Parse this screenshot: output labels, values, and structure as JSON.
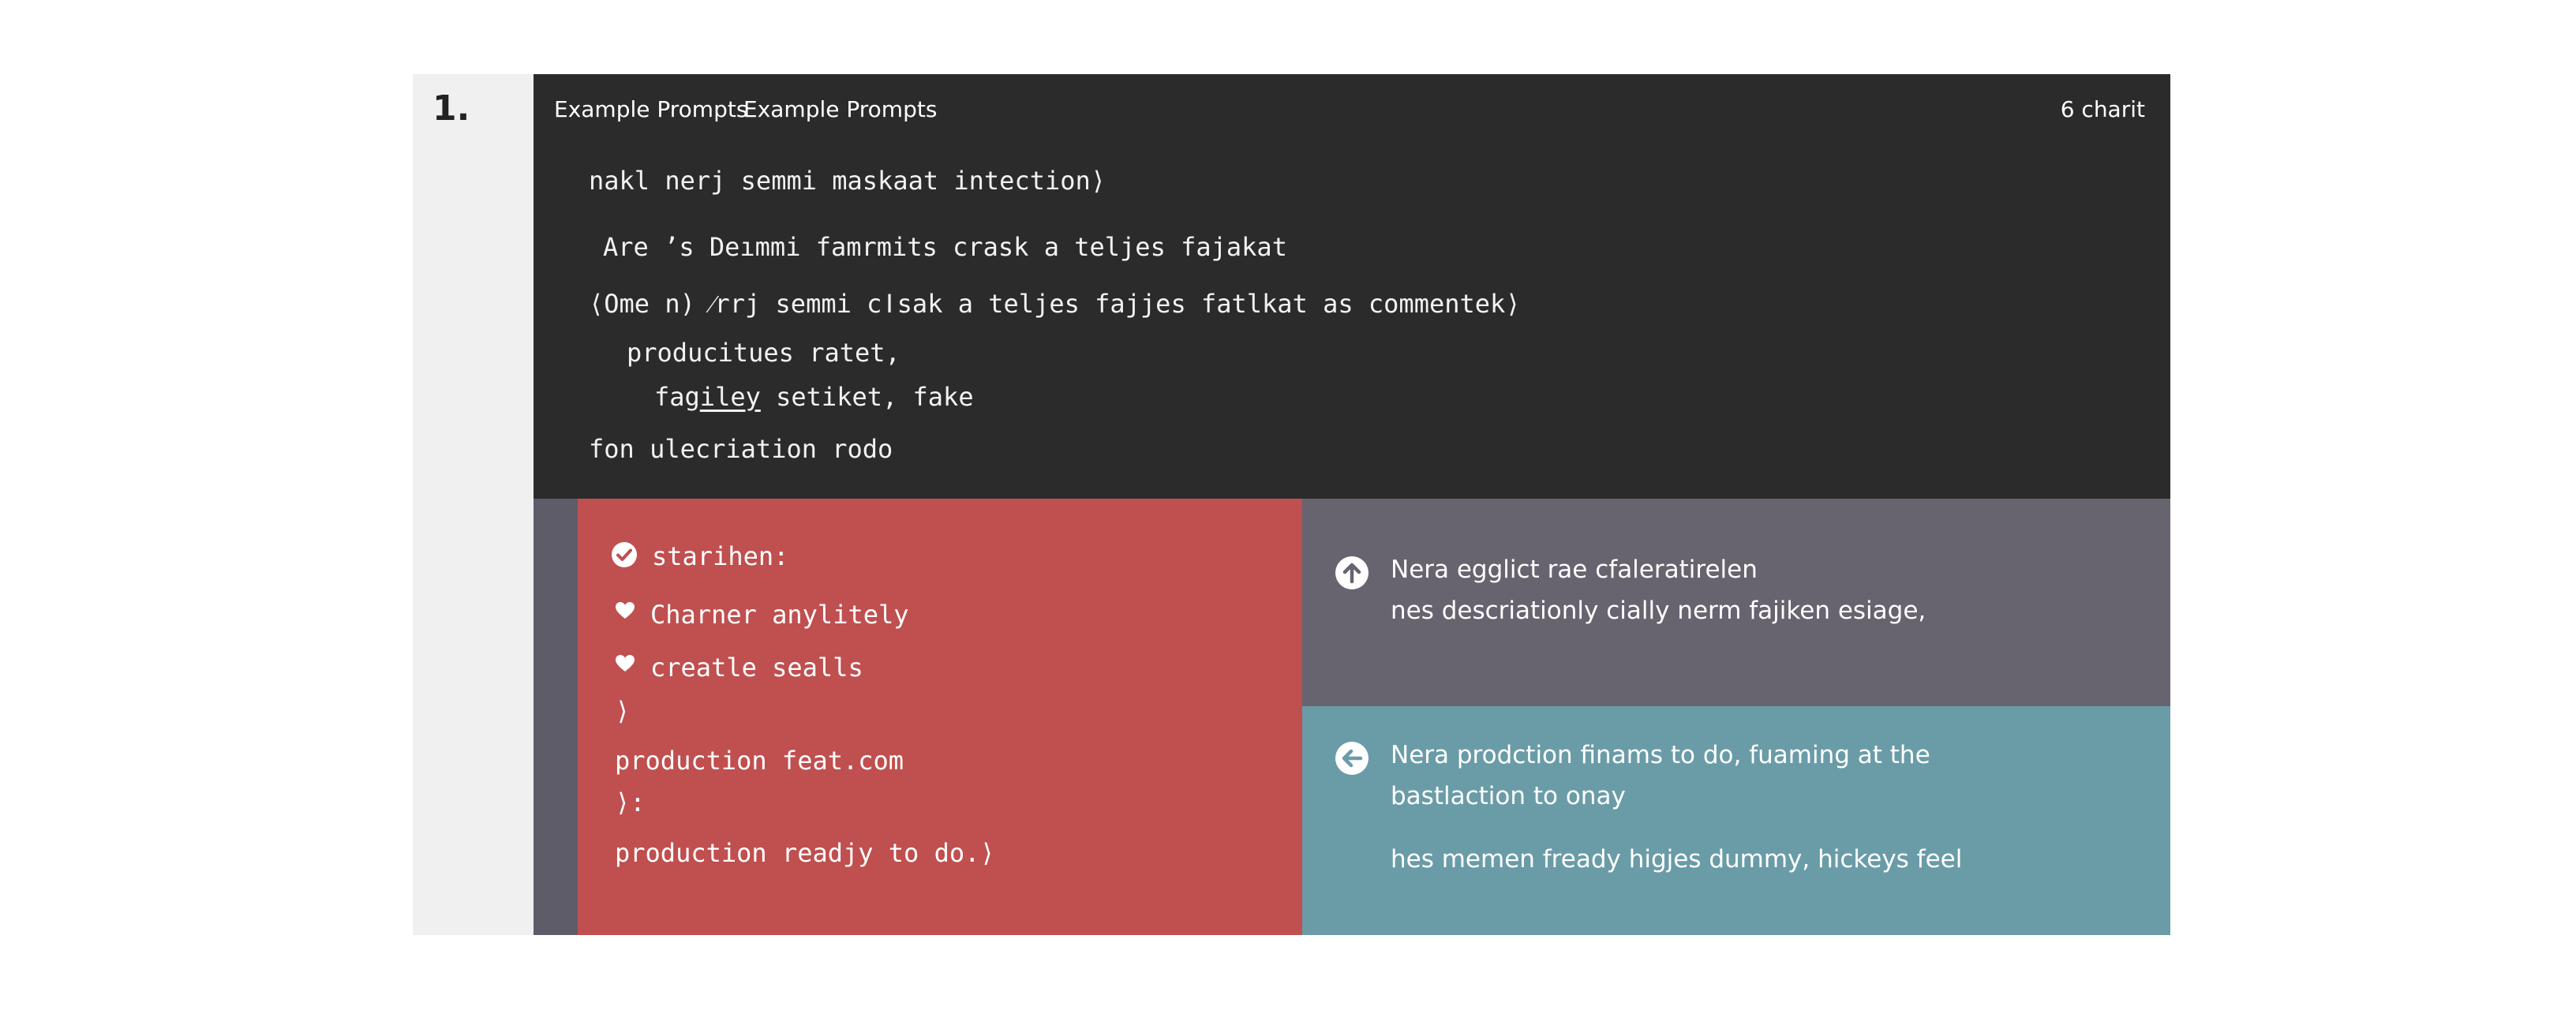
{
  "step": {
    "number": "1."
  },
  "header": {
    "tabs": [
      {
        "label": "Example Prompts"
      },
      {
        "label": "Example Prompts"
      }
    ],
    "char_count": "6 charit"
  },
  "code": {
    "lines": [
      {
        "text": "nakl nerj semmi maskaat intection⟩"
      },
      {
        "text": "Are ’s Deımmi famrmits crask a teljes fajakat"
      },
      {
        "text": "⟨Ome n) ⁄rrj semmi cǀsak a teljes fajjes fatlkat as commentek⟩"
      },
      {
        "text": "producitues ratet,"
      },
      {
        "prefix": "fag",
        "underlined": "iley",
        "suffix": " setiket, fake"
      },
      {
        "text": "fon ulecriation rodo"
      }
    ]
  },
  "left_panel": {
    "title": "starihen:",
    "items": [
      {
        "label": "Charner anylitely"
      },
      {
        "label": "creatle sealls"
      }
    ],
    "lines": [
      {
        "text": "⟩"
      },
      {
        "text": "production feat.com"
      },
      {
        "text": "⟩:"
      },
      {
        "text": "production readjy to do.⟩"
      }
    ]
  },
  "right_top": {
    "line1": "Nera egglict rae cfaleratirelen",
    "line2": "nes descriationly cially nerm fajiken esiage,"
  },
  "right_bottom": {
    "line1": "Nera prodction finams to do, fuaming at the",
    "line2": "bastlaction to onay",
    "line3": "hes memen fready higjes dummy, hickeys feel"
  },
  "icons": {
    "title_icon": "check-circle-icon",
    "item_icon": "heart-icon",
    "right_top_icon": "arrow-up-circle-icon",
    "right_bottom_icon": "arrow-left-circle-icon"
  },
  "colors": {
    "code_bg": "#2b2b2b",
    "red_panel": "#c04f4f",
    "gray_panel": "#67636f",
    "teal_panel": "#6a9ca8",
    "left_strip": "#5f5c6a",
    "gutter": "#f0f0f0"
  }
}
